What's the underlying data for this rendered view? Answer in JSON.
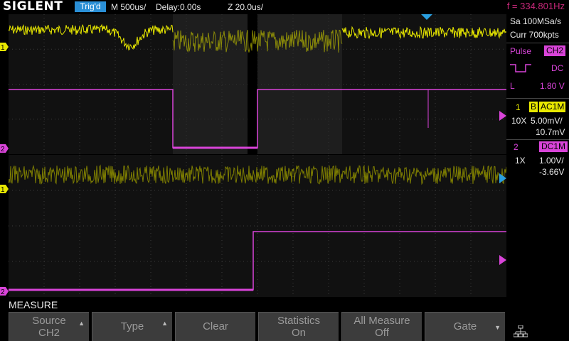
{
  "header": {
    "brand": "SIGLENT",
    "trigger_status": "Trig'd",
    "timebase": "M 500us/",
    "delay": "Delay:0.00s",
    "zoom": "Z 20.0us/",
    "frequency": "f = 334.801Hz"
  },
  "acquisition": {
    "sample_rate": "Sa 100MSa/s",
    "memory": "Curr 700kpts"
  },
  "trigger": {
    "type": "Pulse",
    "source": "CH2",
    "coupling": "DC",
    "level_label": "L",
    "level": "1.80 V"
  },
  "channels": [
    {
      "number": "1",
      "bw_badge": "B",
      "coupling": "AC1M",
      "probe": "10X",
      "scale": "5.00mV/",
      "offset": "10.7mV",
      "color": "#e8e800"
    },
    {
      "number": "2",
      "coupling": "DC1M",
      "probe": "1X",
      "scale": "1.00V/",
      "offset": "-3.66V",
      "color": "#d944d9"
    }
  ],
  "markers": {
    "ch1": "1",
    "ch2": "2"
  },
  "menu": {
    "title": "MEASURE",
    "softkeys": [
      {
        "line1": "Source",
        "line2": "CH2",
        "arrow": "▲"
      },
      {
        "line1": "Type",
        "line2": "",
        "arrow": "▲"
      },
      {
        "line1": "Clear",
        "line2": "",
        "arrow": ""
      },
      {
        "line1": "Statistics",
        "line2": "On",
        "arrow": ""
      },
      {
        "line1": "All Measure",
        "line2": "Off",
        "arrow": ""
      },
      {
        "line1": "Gate",
        "line2": "",
        "arrow": "▼"
      }
    ]
  },
  "icons": {
    "trigger_position": "triangle-down-icon",
    "network": "network-icon",
    "falling_edge": "pulse-polarity-icon"
  }
}
